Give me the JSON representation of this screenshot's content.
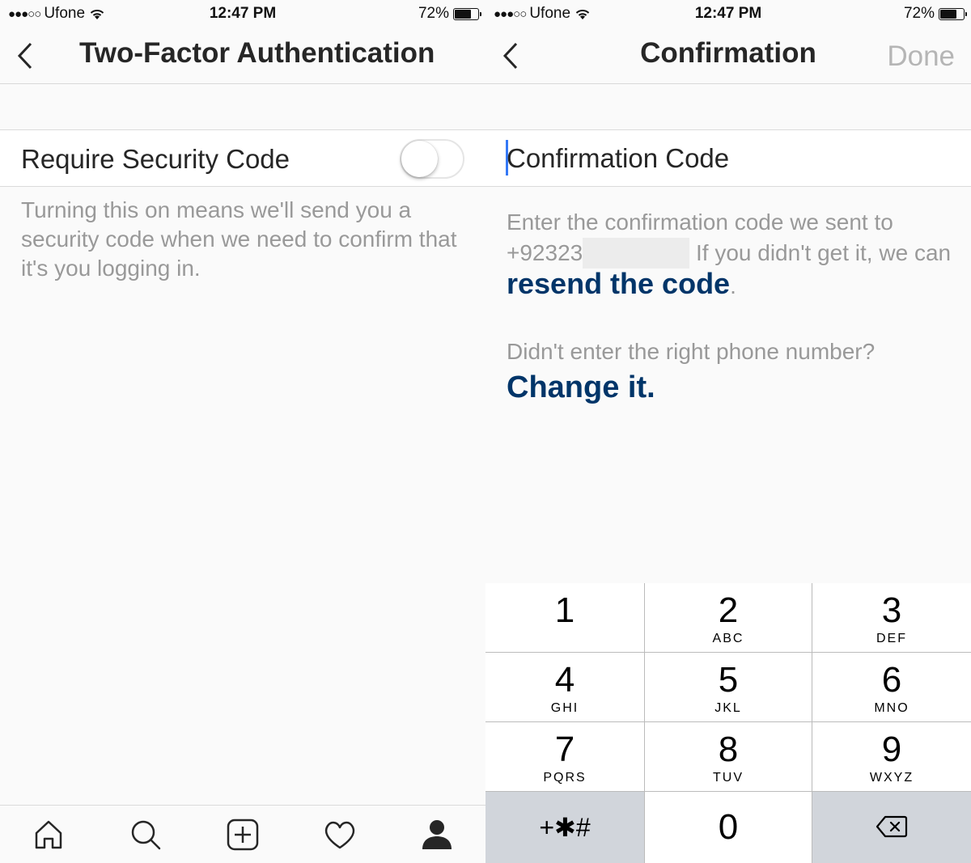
{
  "status": {
    "carrier": "Ufone",
    "time": "12:47 PM",
    "battery": "72%",
    "battery_level": 0.72
  },
  "left": {
    "title": "Two-Factor Authentication",
    "require_label": "Require Security Code",
    "toggle_on": false,
    "description": "Turning this on means we'll send you a security code when we need to confirm that it's you logging in.",
    "tabs": [
      {
        "icon": "home-icon"
      },
      {
        "icon": "search-icon"
      },
      {
        "icon": "add-post-icon"
      },
      {
        "icon": "heart-icon"
      },
      {
        "icon": "profile-icon"
      }
    ]
  },
  "right": {
    "title": "Confirmation",
    "done_label": "Done",
    "code_placeholder": "Confirmation Code",
    "info_prefix": "Enter the confirmation code we sent to",
    "phone_visible": "+92323",
    "info_middle": "If you didn't get it, we can",
    "resend_link": "resend the code",
    "info_period": ".",
    "wrong_number_text": "Didn't enter the right phone number?",
    "change_link": "Change it.",
    "keypad": [
      {
        "num": "1",
        "letters": ""
      },
      {
        "num": "2",
        "letters": "ABC"
      },
      {
        "num": "3",
        "letters": "DEF"
      },
      {
        "num": "4",
        "letters": "GHI"
      },
      {
        "num": "5",
        "letters": "JKL"
      },
      {
        "num": "6",
        "letters": "MNO"
      },
      {
        "num": "7",
        "letters": "PQRS"
      },
      {
        "num": "8",
        "letters": "TUV"
      },
      {
        "num": "9",
        "letters": "WXYZ"
      },
      {
        "num": "+✱#",
        "letters": ""
      },
      {
        "num": "0",
        "letters": ""
      },
      {
        "num": "",
        "letters": "",
        "icon": "backspace-icon"
      }
    ]
  },
  "colors": {
    "link": "#003569",
    "muted": "#999999",
    "cursor": "#3478f6"
  }
}
